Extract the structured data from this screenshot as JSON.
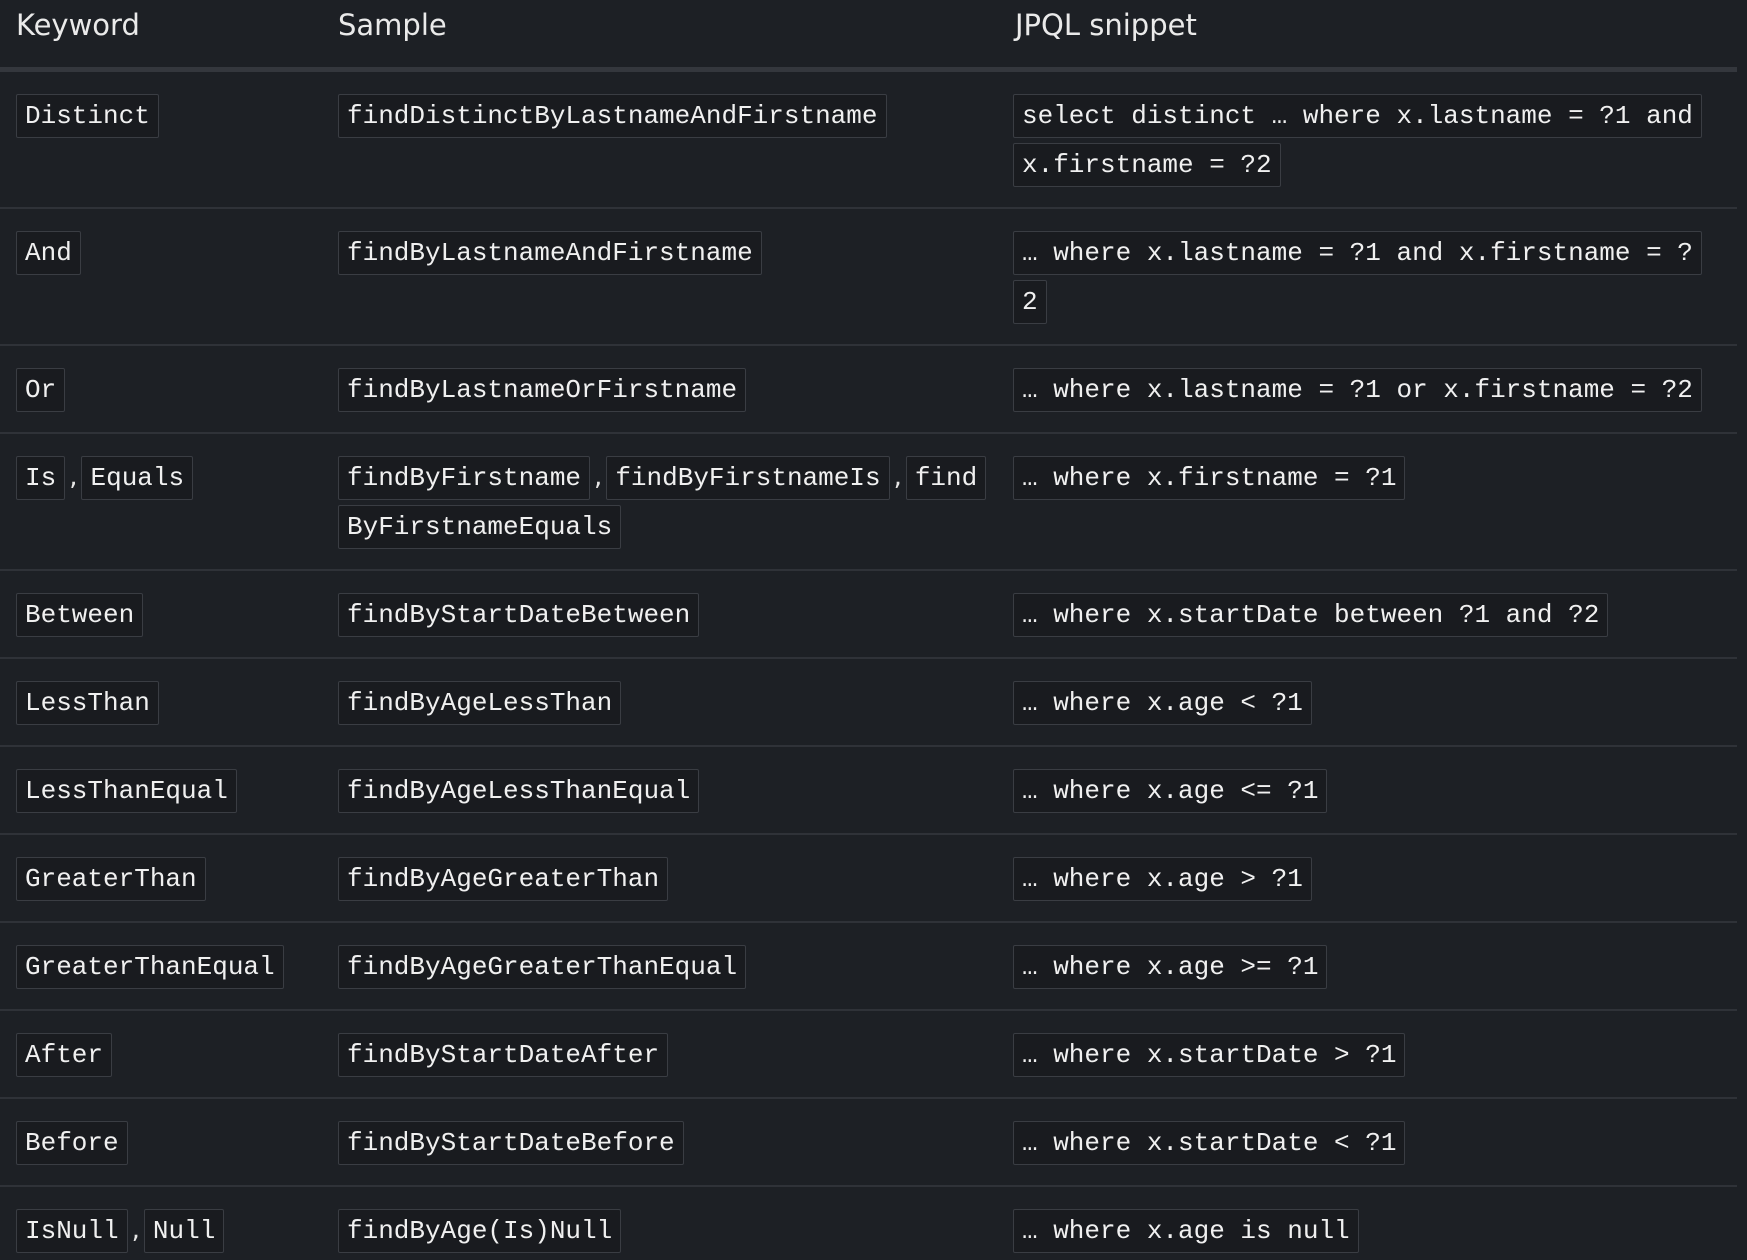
{
  "headers": {
    "keyword": "Keyword",
    "sample": "Sample",
    "jpql": "JPQL snippet"
  },
  "rows": [
    {
      "keywords": [
        "Distinct"
      ],
      "samples": [
        "findDistinctByLastnameAndFirstname"
      ],
      "jpql": "select distinct … where x.lastname = ?1 and x.firstname = ?2"
    },
    {
      "keywords": [
        "And"
      ],
      "samples": [
        "findByLastnameAndFirstname"
      ],
      "jpql": "… where x.lastname = ?1 and x.firstname = ?2"
    },
    {
      "keywords": [
        "Or"
      ],
      "samples": [
        "findByLastnameOrFirstname"
      ],
      "jpql": "… where x.lastname = ?1 or x.firstname = ?2"
    },
    {
      "keywords": [
        "Is",
        "Equals"
      ],
      "samples": [
        "findByFirstname",
        "findByFirstnameIs",
        "findByFirstnameEquals"
      ],
      "jpql": "… where x.firstname = ?1"
    },
    {
      "keywords": [
        "Between"
      ],
      "samples": [
        "findByStartDateBetween"
      ],
      "jpql": "… where x.startDate between ?1 and ?2"
    },
    {
      "keywords": [
        "LessThan"
      ],
      "samples": [
        "findByAgeLessThan"
      ],
      "jpql": "… where x.age < ?1"
    },
    {
      "keywords": [
        "LessThanEqual"
      ],
      "samples": [
        "findByAgeLessThanEqual"
      ],
      "jpql": "… where x.age <= ?1"
    },
    {
      "keywords": [
        "GreaterThan"
      ],
      "samples": [
        "findByAgeGreaterThan"
      ],
      "jpql": "… where x.age > ?1"
    },
    {
      "keywords": [
        "GreaterThanEqual"
      ],
      "samples": [
        "findByAgeGreaterThanEqual"
      ],
      "jpql": "… where x.age >= ?1"
    },
    {
      "keywords": [
        "After"
      ],
      "samples": [
        "findByStartDateAfter"
      ],
      "jpql": "… where x.startDate > ?1"
    },
    {
      "keywords": [
        "Before"
      ],
      "samples": [
        "findByStartDateBefore"
      ],
      "jpql": "… where x.startDate < ?1"
    },
    {
      "keywords": [
        "IsNull",
        "Null"
      ],
      "samples": [
        "findByAge(Is)Null"
      ],
      "jpql": "… where x.age is null"
    }
  ]
}
